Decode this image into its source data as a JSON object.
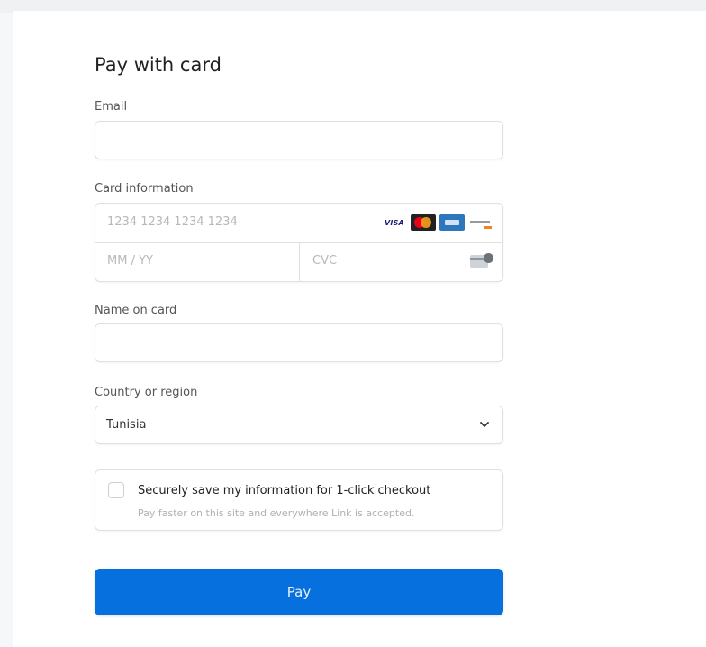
{
  "form": {
    "title": "Pay with card",
    "email": {
      "label": "Email",
      "value": "",
      "placeholder": ""
    },
    "card": {
      "label": "Card information",
      "number_placeholder": "1234 1234 1234 1234",
      "expiry_placeholder": "MM / YY",
      "cvc_placeholder": "CVC",
      "brand_icons": [
        "visa-icon",
        "mastercard-icon",
        "amex-icon",
        "discover-icon"
      ],
      "visa_text": "VISA"
    },
    "name": {
      "label": "Name on card",
      "value": "",
      "placeholder": ""
    },
    "country": {
      "label": "Country or region",
      "selected": "Tunisia"
    },
    "save": {
      "checked": false,
      "title": "Securely save my information for 1-click checkout",
      "subtitle": "Pay faster on this site and everywhere Link is accepted."
    },
    "pay_button": {
      "label": "Pay"
    }
  },
  "colors": {
    "accent": "#0570de",
    "border": "#e0e0e0",
    "placeholder": "#b8b8b8",
    "background": "#f6f7f9"
  }
}
